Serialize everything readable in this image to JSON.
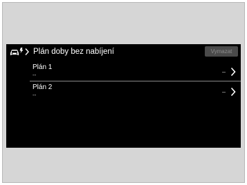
{
  "header": {
    "title": "Plán doby bez nabíjení",
    "delete_label": "Vymazat"
  },
  "plans": [
    {
      "label": "Plán 1",
      "value": "--",
      "indicator": "–"
    },
    {
      "label": "Plán 2",
      "value": "--",
      "indicator": "–"
    }
  ],
  "icons": {
    "header_left": "car-charging-icon",
    "header_separator": "chevron-right-icon",
    "row_action": "chevron-right-icon"
  },
  "colors": {
    "screen_bg": "#000000",
    "frame_bg": "#d6d6d6",
    "text": "#ffffff",
    "divider": "#8a8a8a",
    "button_bg": "#4a4a4a"
  }
}
